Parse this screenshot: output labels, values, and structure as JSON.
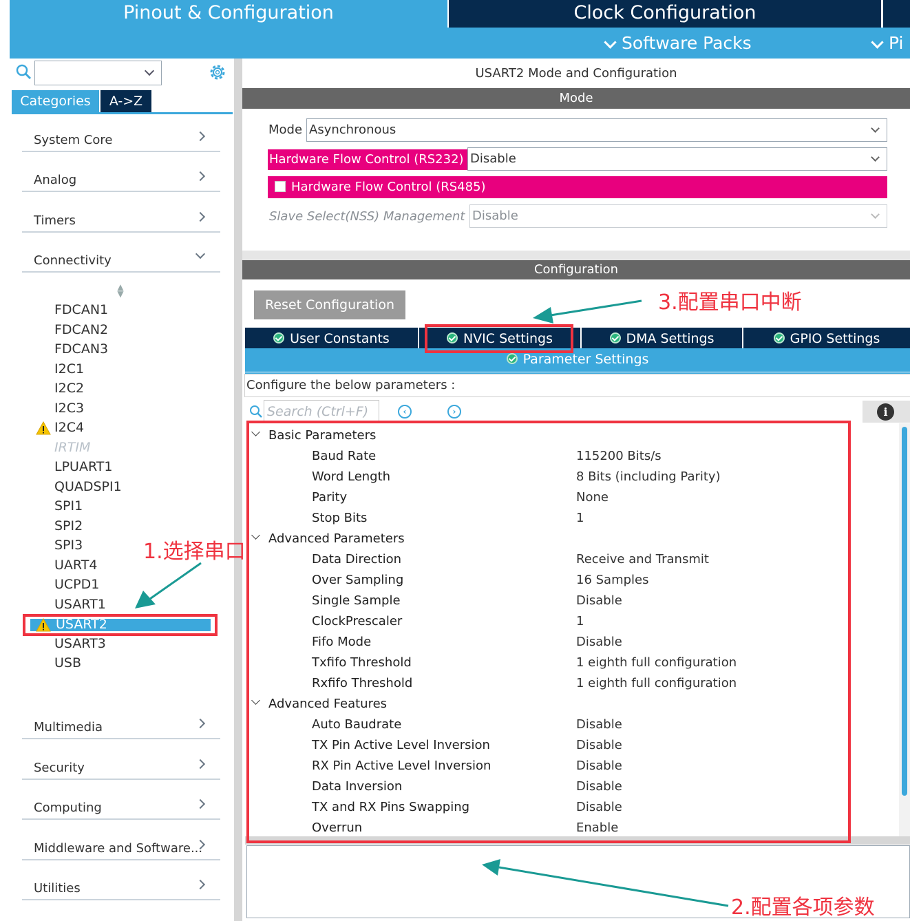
{
  "top_tabs": {
    "pinout": "Pinout & Configuration",
    "clock": "Clock Configuration",
    "software_packs": "Software Packs",
    "pinout_short": "Pi"
  },
  "left": {
    "tabs": {
      "categories": "Categories",
      "az": "A->Z"
    },
    "categories_top": [
      "System Core",
      "Analog",
      "Timers",
      "Connectivity"
    ],
    "peripherals": [
      "FDCAN1",
      "FDCAN2",
      "FDCAN3",
      "I2C1",
      "I2C2",
      "I2C3",
      "I2C4",
      "IRTIM",
      "LPUART1",
      "QUADSPI1",
      "SPI1",
      "SPI2",
      "SPI3",
      "UART4",
      "UCPD1",
      "USART1",
      "USART2",
      "USART3",
      "USB"
    ],
    "categories_bottom": [
      "Multimedia",
      "Security",
      "Computing",
      "Middleware and Software...",
      "Utilities"
    ],
    "selected": "USART2"
  },
  "annotations": {
    "step1": "1.选择串口",
    "step2": "2.配置各项参数",
    "step3": "3.配置串口中断"
  },
  "right": {
    "title": "USART2 Mode and Configuration",
    "mode_header": "Mode",
    "mode": {
      "mode_label": "Mode",
      "mode_value": "Asynchronous",
      "hfc232_label": "Hardware Flow Control (RS232)",
      "hfc232_value": "Disable",
      "hfc485_label": "Hardware Flow Control (RS485)",
      "nss_label": "Slave Select(NSS) Management",
      "nss_value": "Disable"
    },
    "config_header": "Configuration",
    "reset_button": "Reset Configuration",
    "tabs": [
      "User Constants",
      "NVIC Settings",
      "DMA Settings",
      "GPIO Settings"
    ],
    "param_tab": "Parameter Settings",
    "configure_text": "Configure the below parameters :",
    "search_placeholder": "Search (Ctrl+F)",
    "groups": [
      {
        "name": "Basic Parameters",
        "params": [
          {
            "name": "Baud Rate",
            "value": "115200 Bits/s"
          },
          {
            "name": "Word Length",
            "value": "8 Bits (including Parity)"
          },
          {
            "name": "Parity",
            "value": "None"
          },
          {
            "name": "Stop Bits",
            "value": "1"
          }
        ]
      },
      {
        "name": "Advanced Parameters",
        "params": [
          {
            "name": "Data Direction",
            "value": "Receive and Transmit"
          },
          {
            "name": "Over Sampling",
            "value": "16 Samples"
          },
          {
            "name": "Single Sample",
            "value": "Disable"
          },
          {
            "name": "ClockPrescaler",
            "value": "1"
          },
          {
            "name": "Fifo Mode",
            "value": "Disable"
          },
          {
            "name": "Txfifo Threshold",
            "value": "1 eighth full configuration"
          },
          {
            "name": "Rxfifo Threshold",
            "value": "1 eighth full configuration"
          }
        ]
      },
      {
        "name": "Advanced Features",
        "params": [
          {
            "name": "Auto Baudrate",
            "value": "Disable"
          },
          {
            "name": "TX Pin Active Level Inversion",
            "value": "Disable"
          },
          {
            "name": "RX Pin Active Level Inversion",
            "value": "Disable"
          },
          {
            "name": "Data Inversion",
            "value": "Disable"
          },
          {
            "name": "TX and RX Pins Swapping",
            "value": "Disable"
          },
          {
            "name": "Overrun",
            "value": "Enable"
          }
        ]
      }
    ]
  },
  "colors": {
    "accent": "#3ca8dc",
    "dark_tab": "#062a4e",
    "header_gray": "#666666",
    "highlight_pink": "#e8007e",
    "annotation_red": "#ef3340",
    "arrow_teal": "#1a9a94"
  },
  "icons": [
    "search-icon",
    "gear-icon",
    "chevron-right-icon",
    "chevron-down-icon",
    "warning-icon",
    "check-circle-icon",
    "info-icon",
    "prev-match-icon",
    "next-match-icon"
  ]
}
